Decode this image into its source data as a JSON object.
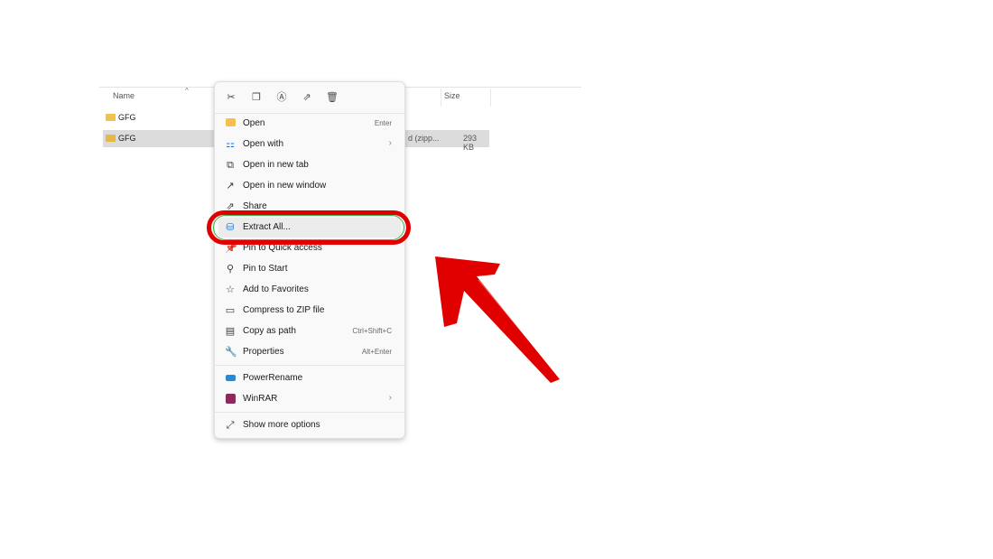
{
  "explorer": {
    "columns": {
      "name": "Name",
      "size": "Size"
    },
    "rows": [
      {
        "name": "GFG",
        "type": "",
        "size": "",
        "selected": false,
        "kind": "folder"
      },
      {
        "name": "GFG",
        "type": "d (zipp...",
        "size": "293 KB",
        "selected": true,
        "kind": "zip"
      }
    ]
  },
  "menu": {
    "toolbar": [
      "cut-icon",
      "copy-icon",
      "rename-icon",
      "share-icon",
      "delete-icon"
    ],
    "items": [
      {
        "label": "Open",
        "shortcut": "Enter",
        "icon": "folder-icon"
      },
      {
        "label": "Open with",
        "shortcut": "",
        "icon": "open-with-icon",
        "submenu": true
      },
      {
        "label": "Open in new tab",
        "shortcut": "",
        "icon": "new-tab-icon"
      },
      {
        "label": "Open in new window",
        "shortcut": "",
        "icon": "new-window-icon"
      },
      {
        "label": "Share",
        "shortcut": "",
        "icon": "share-icon"
      },
      {
        "label": "Extract All...",
        "shortcut": "",
        "icon": "extract-icon"
      },
      {
        "label": "Pin to Quick access",
        "shortcut": "",
        "icon": "pin-icon"
      },
      {
        "label": "Pin to Start",
        "shortcut": "",
        "icon": "pin-icon"
      },
      {
        "label": "Add to Favorites",
        "shortcut": "",
        "icon": "star-icon"
      },
      {
        "label": "Compress to ZIP file",
        "shortcut": "",
        "icon": "zip-icon"
      },
      {
        "label": "Copy as path",
        "shortcut": "Ctrl+Shift+C",
        "icon": "path-icon"
      },
      {
        "label": "Properties",
        "shortcut": "Alt+Enter",
        "icon": "wrench-icon"
      },
      {
        "label": "PowerRename",
        "shortcut": "",
        "icon": "powerrename-icon"
      },
      {
        "label": "WinRAR",
        "shortcut": "",
        "icon": "winrar-icon",
        "submenu": true
      },
      {
        "label": "Show more options",
        "shortcut": "",
        "icon": "more-options-icon"
      }
    ]
  },
  "annotation": {
    "ring_color": "#e00000",
    "arrow_color": "#e00000"
  }
}
